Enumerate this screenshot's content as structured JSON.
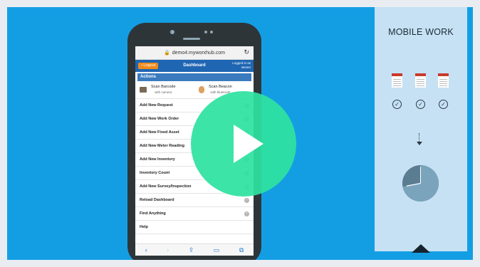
{
  "phone": {
    "url": "demo4.myworxhub.com",
    "logout_label": "Logout",
    "dashboard_title": "Dashboard",
    "logged_in_line1": "Logged in as",
    "logged_in_line2": "steven",
    "actions_header": "Actions",
    "scan_barcode": {
      "title": "Scan Barcode",
      "subtitle": "with camera"
    },
    "scan_beacon": {
      "title": "Scan Beacon",
      "subtitle": "with bluetooth"
    },
    "menu_items": [
      "Add New Request",
      "Add New Work Order",
      "Add New Fixed Asset",
      "Add New Meter Reading",
      "Add New Inventory",
      "Inventory Count",
      "Add New Survey/Inspection",
      "Reload Dashboard",
      "Find Anything",
      "Help"
    ]
  },
  "panel": {
    "title": "MOBILE WORK",
    "check_glyph": "✓",
    "clock_progress": 0.72
  },
  "colors": {
    "background": "#139ee3",
    "panel": "#c6e1f4",
    "play": "#2ee2a0",
    "app_bar": "#1f66b3",
    "logout": "#ef8a1b"
  },
  "icons": [
    "lock-icon",
    "reload-icon",
    "back-icon",
    "forward-icon",
    "share-icon",
    "book-icon",
    "tabs-icon",
    "document-icon",
    "check-circle-icon",
    "down-arrow-icon",
    "clock-icon",
    "chevron-up-icon",
    "play-icon"
  ]
}
